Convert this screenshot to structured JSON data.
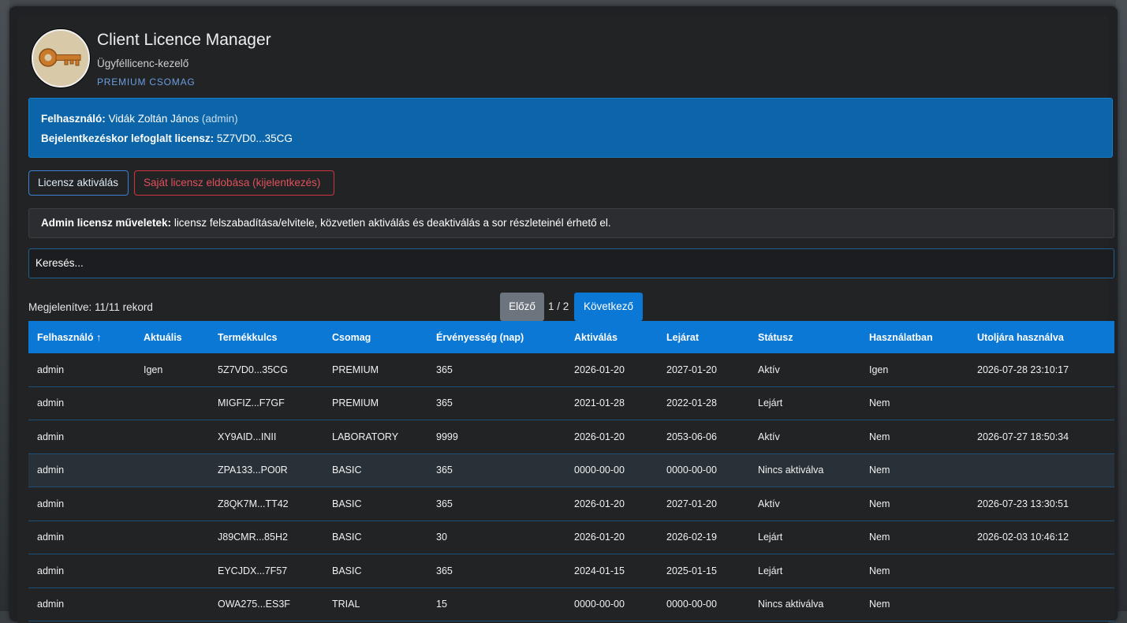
{
  "app": {
    "title": "Client Licence Manager",
    "subtitle": "Ügyféllicenc-kezelő",
    "plan": "PREMIUM CSOMAG",
    "logo_icon": "key-icon"
  },
  "user_info": {
    "user_label": "Felhasználó:",
    "user_name": "Vidák Zoltán János",
    "user_role": "(admin)",
    "license_label": "Bejelentkezéskor lefoglalt licensz:",
    "license_value": "5Z7VD0...35CG"
  },
  "actions": {
    "activate_label": "Licensz aktiválás",
    "drop_label": "Saját licensz eldobása (kijelentkezés)"
  },
  "admin_note": {
    "bold": "Admin licensz műveletek:",
    "text": " licensz felszabadítása/elvitele, közvetlen aktiválás és deaktiválás a sor részleteinél érhető el."
  },
  "search": {
    "placeholder": "Keresés..."
  },
  "pagination": {
    "count_text": "Megjelenítve: 11/11 rekord",
    "prev_label": "Előző",
    "page_info": "1 / 2",
    "next_label": "Következő"
  },
  "colors": {
    "accent": "#0b78d6",
    "info_bg": "#0b65a8",
    "danger": "#d0343f",
    "secondary": "#6c757d"
  },
  "table": {
    "columns": [
      "Felhasználó ↑",
      "Aktuális",
      "Termékkulcs",
      "Csomag",
      "Érvényesség (nap)",
      "Aktiválás",
      "Lejárat",
      "Státusz",
      "Használatban",
      "Utoljára használva"
    ],
    "rows": [
      [
        "admin",
        "Igen",
        "5Z7VD0...35CG",
        "PREMIUM",
        "365",
        "2026-01-20",
        "2027-01-20",
        "Aktív",
        "Igen",
        "2026-07-28 23:10:17"
      ],
      [
        "admin",
        "",
        "MIGFIZ...F7GF",
        "PREMIUM",
        "365",
        "2021-01-28",
        "2022-01-28",
        "Lejárt",
        "Nem",
        ""
      ],
      [
        "admin",
        "",
        "XY9AID...INII",
        "LABORATORY",
        "9999",
        "2026-01-20",
        "2053-06-06",
        "Aktív",
        "Nem",
        "2026-07-27 18:50:34"
      ],
      [
        "admin",
        "",
        "ZPA133...PO0R",
        "BASIC",
        "365",
        "0000-00-00",
        "0000-00-00",
        "Nincs aktiválva",
        "Nem",
        ""
      ],
      [
        "admin",
        "",
        "Z8QK7M...TT42",
        "BASIC",
        "365",
        "2026-01-20",
        "2027-01-20",
        "Aktív",
        "Nem",
        "2026-07-23 13:30:51"
      ],
      [
        "admin",
        "",
        "J89CMR...85H2",
        "BASIC",
        "30",
        "2026-01-20",
        "2026-02-19",
        "Lejárt",
        "Nem",
        "2026-02-03 10:46:12"
      ],
      [
        "admin",
        "",
        "EYCJDX...7F57",
        "BASIC",
        "365",
        "2024-01-15",
        "2025-01-15",
        "Lejárt",
        "Nem",
        ""
      ],
      [
        "admin",
        "",
        "OWA275...ES3F",
        "TRIAL",
        "15",
        "0000-00-00",
        "0000-00-00",
        "Nincs aktiválva",
        "Nem",
        ""
      ]
    ]
  }
}
